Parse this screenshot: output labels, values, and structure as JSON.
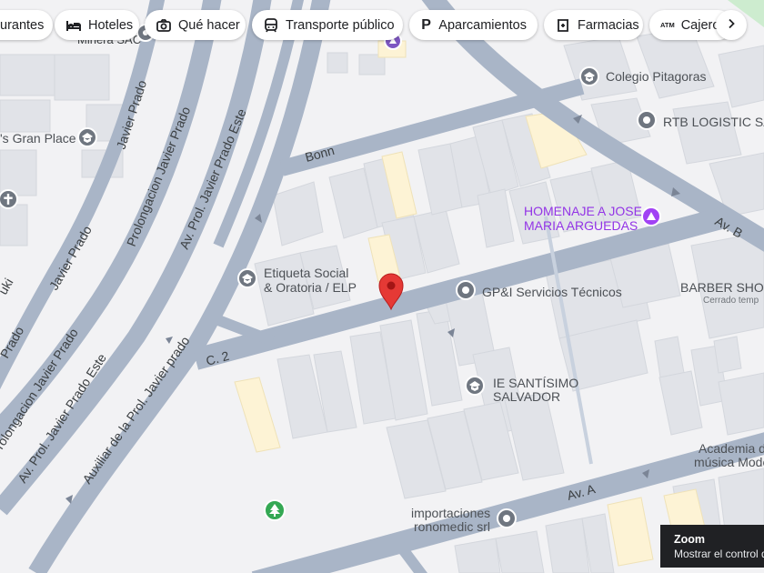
{
  "chips": [
    {
      "label": "urantes",
      "icon": "restaurant-icon"
    },
    {
      "label": "Hoteles",
      "icon": "hotel-icon"
    },
    {
      "label": "Qué hacer",
      "icon": "camera-icon"
    },
    {
      "label": "Transporte público",
      "icon": "transit-icon"
    },
    {
      "label": "Aparcamientos",
      "icon": "parking-icon"
    },
    {
      "label": "Farmacias",
      "icon": "pharmacy-icon"
    },
    {
      "label": "Cajeros",
      "icon": "atm-icon",
      "icon_text": "ATM"
    }
  ],
  "map_labels": {
    "minera": "Minera SAC",
    "grand_place": "'s Gran Place",
    "javier_prado_1": "Javier Prado",
    "javier_prado_2": "Javier Prado",
    "prolongacion": "Prolongacion Javier Prado",
    "av_prol_este_top": "Av. Prol. Javier Prado Este",
    "prolongacion_bottom": "rolongacion Javier Prado",
    "av_prol_este_bottom": "Av. Prol. Javier Prado Este",
    "auxiliar": "Auxiliar de la Prol. Javier prado",
    "prado_left": "Prado",
    "uki": "uki",
    "bonn": "Bonn",
    "c2": "C. 2",
    "av_a": "Av. A",
    "av_b": "Av. B",
    "colegio": "Colegio Pitagoras",
    "rtb": "RTB LOGISTIC SA",
    "homenaje_1": "HOMENAJE A JOSE",
    "homenaje_2": "MARIA ARGUEDAS",
    "etiqueta_1": "Etiqueta Social",
    "etiqueta_2": "& Oratoria / ELP",
    "gpi": "GP&I Servicios Técnicos",
    "barber": "BARBER SHOP",
    "barber_status": "Cerrado temp",
    "ie_1": "IE SANTÍSIMO",
    "ie_2": "SALVADOR",
    "academia_1": "Academia d",
    "academia_2": "música Moderat",
    "importaciones_1": "importaciones",
    "importaciones_2": "ronomedic srl"
  },
  "zoom_tip": {
    "title": "Zoom",
    "text": "Mostrar el control d"
  },
  "colors": {
    "road": "#a9b5c7",
    "block": "#e1e3e8",
    "block_yellow": "#fdf3d5",
    "background": "#f2f2f4",
    "pin": "#e53935",
    "poi_gray": "#6f7680",
    "poi_purple": "#a142f4",
    "park_green": "#34a853"
  }
}
